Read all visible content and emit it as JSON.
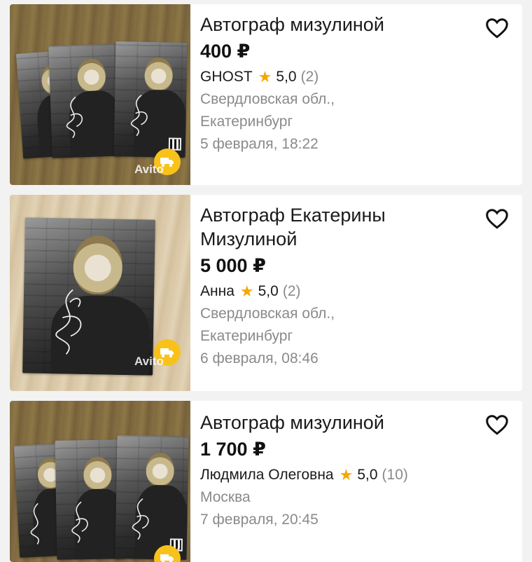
{
  "listings": [
    {
      "title": "Автограф мизулиной",
      "price": "400 ₽",
      "seller": "GHOST",
      "rating": "5,0",
      "reviews": "(2)",
      "location_line1": "Свердловская обл.,",
      "location_line2": "Екатеринбург",
      "date": "5 февраля, 18:22",
      "delivery_icon": "delivery-truck-icon",
      "favorite_icon": "heart-outline-icon"
    },
    {
      "title_line1": "Автограф Екатерины",
      "title_line2": "Мизулиной",
      "price": "5 000 ₽",
      "seller": "Анна",
      "rating": "5,0",
      "reviews": "(2)",
      "location_line1": "Свердловская обл.,",
      "location_line2": "Екатеринбург",
      "date": "6 февраля, 08:46",
      "delivery_icon": "delivery-truck-icon",
      "favorite_icon": "heart-outline-icon"
    },
    {
      "title": "Автограф мизулиной",
      "price": "1 700 ₽",
      "seller": "Людмила Олеговна",
      "rating": "5,0",
      "reviews": "(10)",
      "location_line1": "Москва",
      "date": "7 февраля, 20:45",
      "delivery_icon": "delivery-truck-icon",
      "favorite_icon": "heart-outline-icon"
    }
  ],
  "watermark": "Avito",
  "colors": {
    "star": "#f5a700",
    "delivery_badge": "#f8c21a",
    "muted_text": "#8a8a8a",
    "card_bg": "#ffffff",
    "page_bg": "#f2f2f2"
  }
}
